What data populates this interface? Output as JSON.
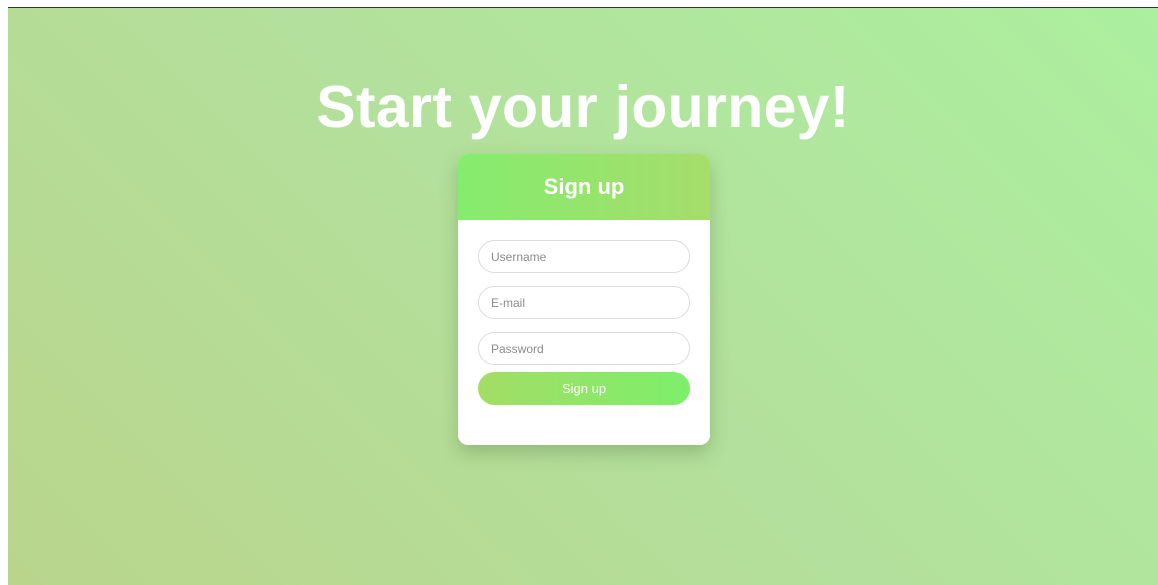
{
  "page": {
    "headline": "Start your journey!"
  },
  "signup_card": {
    "title": "Sign up",
    "fields": {
      "username": {
        "placeholder": "Username",
        "value": ""
      },
      "email": {
        "placeholder": "E-mail",
        "value": ""
      },
      "password": {
        "placeholder": "Password",
        "value": ""
      }
    },
    "submit_label": "Sign up"
  },
  "colors": {
    "background_start": "#b9d58c",
    "background_end": "#acef9f",
    "header_start": "#85ec6e",
    "header_end": "#a6dd6b",
    "button_start": "#a4dd66",
    "button_end": "#7def6a",
    "text_on_accent": "#ffffff"
  }
}
